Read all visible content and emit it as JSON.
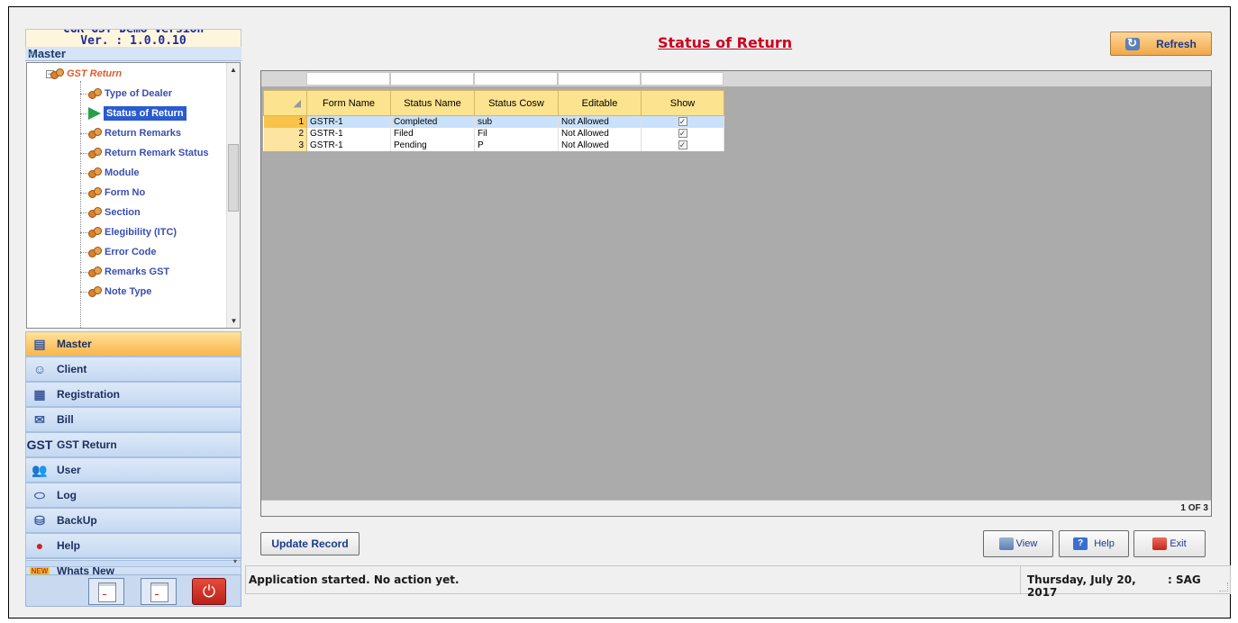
{
  "app": {
    "version_banner_cut": "CGR GST Demo Version",
    "version": "Ver. : 1.0.0.10"
  },
  "sidebar": {
    "header": "Master",
    "collapse_glyph": "«",
    "tree": {
      "parent": "GST Return",
      "items": [
        {
          "label": "Type of Dealer"
        },
        {
          "label": "Status of Return",
          "selected": true
        },
        {
          "label": "Return Remarks"
        },
        {
          "label": "Return Remark Status"
        },
        {
          "label": "Module"
        },
        {
          "label": "Form No"
        },
        {
          "label": "Section"
        },
        {
          "label": "Elegibility (ITC)"
        },
        {
          "label": "Error Code"
        },
        {
          "label": "Remarks GST"
        },
        {
          "label": "Note Type"
        }
      ]
    },
    "nav": [
      {
        "label": "Master",
        "active": true,
        "icon": "master-icon"
      },
      {
        "label": "Client",
        "icon": "client-icon"
      },
      {
        "label": "Registration",
        "icon": "registration-icon"
      },
      {
        "label": "Bill",
        "icon": "bill-icon"
      },
      {
        "label": "GST Return",
        "icon": "gst-icon",
        "icon_text": "GST"
      },
      {
        "label": "User",
        "icon": "user-icon"
      },
      {
        "label": "Log",
        "icon": "log-icon"
      },
      {
        "label": "BackUp",
        "icon": "backup-icon"
      },
      {
        "label": "Help",
        "icon": "help-icon"
      },
      {
        "label": "Whats New",
        "icon": "new-icon",
        "icon_text": "NEW"
      }
    ]
  },
  "main": {
    "title": "Status of Return",
    "refresh_label": "Refresh",
    "grid": {
      "columns": [
        "Form Name",
        "Status Name",
        "Status Cosw",
        "Editable",
        "Show"
      ],
      "rows": [
        {
          "n": "1",
          "form": "GSTR-1",
          "status": "Completed",
          "cosw": "sub",
          "editable": "Not Allowed",
          "show": true
        },
        {
          "n": "2",
          "form": "GSTR-1",
          "status": "Filed",
          "cosw": "Fil",
          "editable": "Not Allowed",
          "show": true
        },
        {
          "n": "3",
          "form": "GSTR-1",
          "status": "Pending",
          "cosw": "P",
          "editable": "Not Allowed",
          "show": true
        }
      ],
      "pager": "1 OF 3"
    },
    "update_label": "Update Record",
    "view_label": "View",
    "help_label": "Help",
    "exit_label": "Exit"
  },
  "status": {
    "message": "Application started. No action yet.",
    "date": "Thursday, July 20, 2017",
    "user": ": SAG"
  },
  "colors": {
    "title": "#cc0020",
    "grid_header": "#fce38f",
    "selected_row": "#c9e1fb",
    "nav_active": "#f9b54a"
  }
}
